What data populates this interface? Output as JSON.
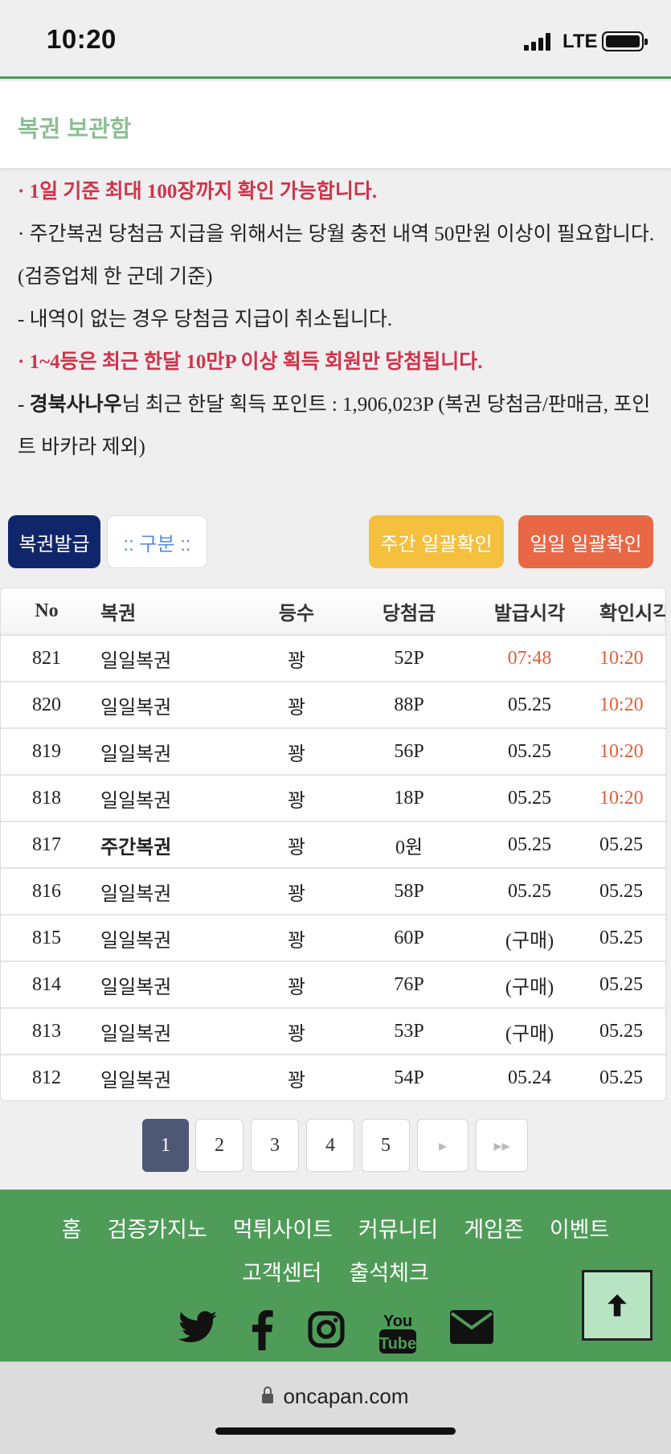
{
  "status_bar": {
    "time": "10:20",
    "network": "LTE"
  },
  "page": {
    "title": "복권 보관함"
  },
  "notices": {
    "line1": "· 1일 기준 최대 100장까지 확인 가능합니다.",
    "line2": "· 주간복권 당첨금 지급을 위해서는 당월 충전 내역 50만원 이상이 필요합니다. (검증업체 한 군데 기준)",
    "line3": " - 내역이 없는 경우 당첨금 지급이 취소됩니다.",
    "line4": "· 1~4등은 최근 한달 10만P 이상 획득 회원만 당첨됩니다.",
    "line5_prefix": " - ",
    "line5_user": "경북사나우",
    "line5_rest": "님 최근 한달 획득 포인트 : 1,906,023P (복권 당첨금/판매금, 포인트 바카라 제외)"
  },
  "buttons": {
    "issue": "복권발급",
    "category": ":: 구분 ::",
    "weekly_check": "주간 일괄확인",
    "daily_check": "일일 일괄확인"
  },
  "table": {
    "headers": {
      "no": "No",
      "name": "복권",
      "rank": "등수",
      "prize": "당첨금",
      "issued": "발급시각",
      "checked": "확인시각"
    },
    "rows": [
      {
        "no": "821",
        "name": "일일복권",
        "rank": "꽝",
        "prize": "52P",
        "issued": "07:48",
        "checked": "10:20"
      },
      {
        "no": "820",
        "name": "일일복권",
        "rank": "꽝",
        "prize": "88P",
        "issued": "05.25",
        "checked": "10:20"
      },
      {
        "no": "819",
        "name": "일일복권",
        "rank": "꽝",
        "prize": "56P",
        "issued": "05.25",
        "checked": "10:20"
      },
      {
        "no": "818",
        "name": "일일복권",
        "rank": "꽝",
        "prize": "18P",
        "issued": "05.25",
        "checked": "10:20"
      },
      {
        "no": "817",
        "name": "주간복권",
        "rank": "꽝",
        "prize": "0원",
        "issued": "05.25",
        "checked": "05.25"
      },
      {
        "no": "816",
        "name": "일일복권",
        "rank": "꽝",
        "prize": "58P",
        "issued": "05.25",
        "checked": "05.25"
      },
      {
        "no": "815",
        "name": "일일복권",
        "rank": "꽝",
        "prize": "60P",
        "issued": "(구매)",
        "checked": "05.25"
      },
      {
        "no": "814",
        "name": "일일복권",
        "rank": "꽝",
        "prize": "76P",
        "issued": "(구매)",
        "checked": "05.25"
      },
      {
        "no": "813",
        "name": "일일복권",
        "rank": "꽝",
        "prize": "53P",
        "issued": "(구매)",
        "checked": "05.25"
      },
      {
        "no": "812",
        "name": "일일복권",
        "rank": "꽝",
        "prize": "54P",
        "issued": "05.24",
        "checked": "05.25"
      }
    ]
  },
  "pagination": {
    "pages": [
      "1",
      "2",
      "3",
      "4",
      "5"
    ],
    "current": "1",
    "next_icon": "next-icon",
    "last_icon": "last-page-icon"
  },
  "footer": {
    "nav": [
      "홈",
      "검증카지노",
      "먹튀사이트",
      "커뮤니티",
      "게임존",
      "이벤트",
      "고객센터",
      "출석체크"
    ],
    "social_icons": [
      "twitter-icon",
      "facebook-icon",
      "instagram-icon",
      "youtube-icon",
      "mail-icon"
    ]
  },
  "url_bar": {
    "url": "oncapan.com"
  },
  "colors": {
    "accent_green": "#4f9c59",
    "highlight_red": "#d0334b",
    "time_orange": "#e0603a",
    "issue_btn": "#10266b",
    "weekly_btn": "#f4c03e",
    "daily_btn": "#e86846"
  }
}
